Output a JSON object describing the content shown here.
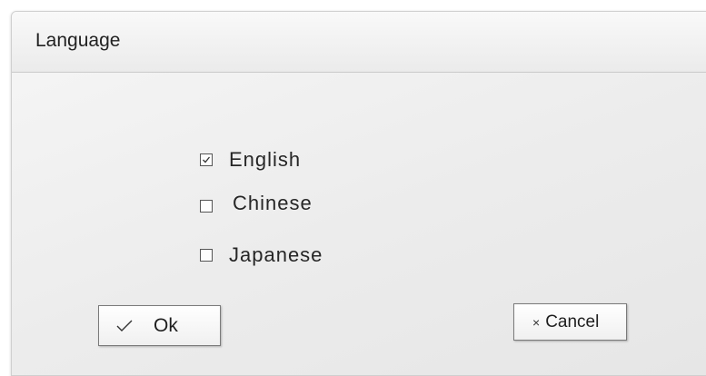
{
  "dialog": {
    "title": "Language",
    "options": [
      {
        "label": "English",
        "checked": true
      },
      {
        "label": "Chinese",
        "checked": false
      },
      {
        "label": "Japanese",
        "checked": false
      }
    ],
    "ok_button": {
      "label": "Ok",
      "icon": "checkmark-icon"
    },
    "cancel_button": {
      "label": "Cancel",
      "icon": "close-icon",
      "icon_glyph": "×"
    }
  }
}
